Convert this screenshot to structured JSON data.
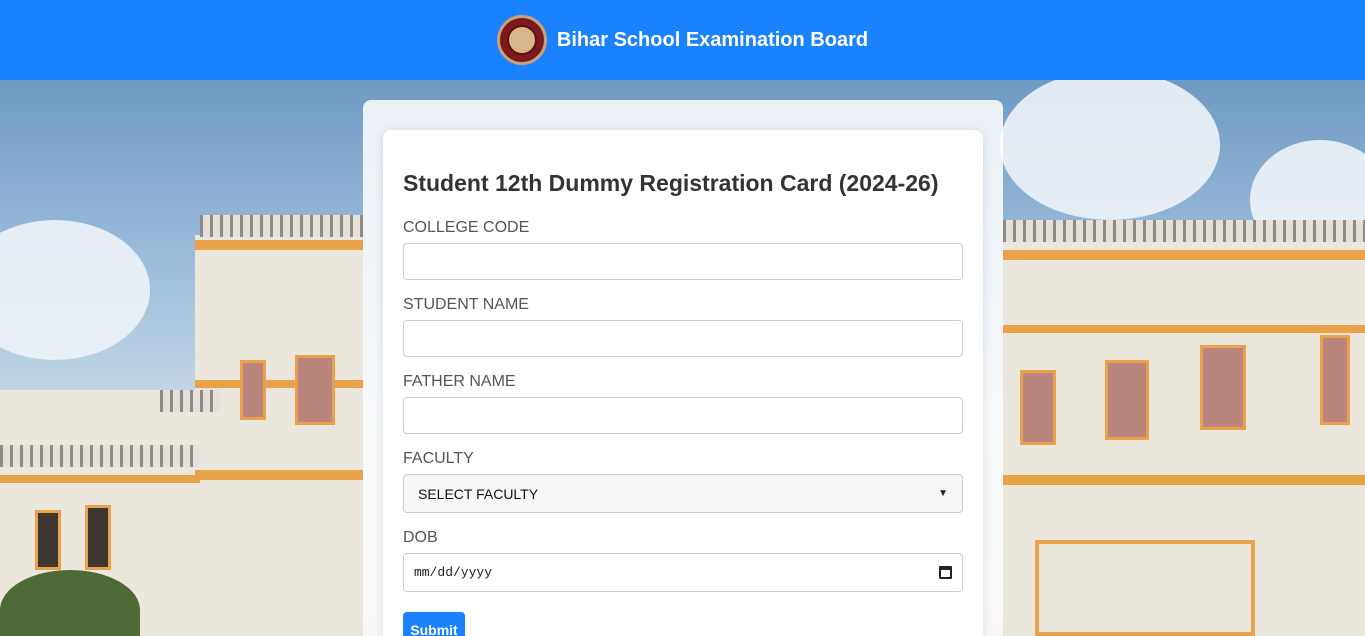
{
  "header": {
    "logo_icon": "bseb-emblem-icon",
    "title": "Bihar School Examination Board"
  },
  "form": {
    "title": "Student 12th Dummy Registration Card (2024-26)",
    "college_code": {
      "label": "COLLEGE CODE",
      "value": ""
    },
    "student_name": {
      "label": "STUDENT NAME",
      "value": ""
    },
    "father_name": {
      "label": "FATHER NAME",
      "value": ""
    },
    "faculty": {
      "label": "FACULTY",
      "selected": "SELECT FACULTY"
    },
    "dob": {
      "label": "DOB",
      "placeholder": "mm/dd/yyyy",
      "icon": "calendar-icon"
    },
    "submit_label": "Submit"
  },
  "colors": {
    "header_bg": "#1a82ff",
    "button_bg": "#1a82ff"
  }
}
